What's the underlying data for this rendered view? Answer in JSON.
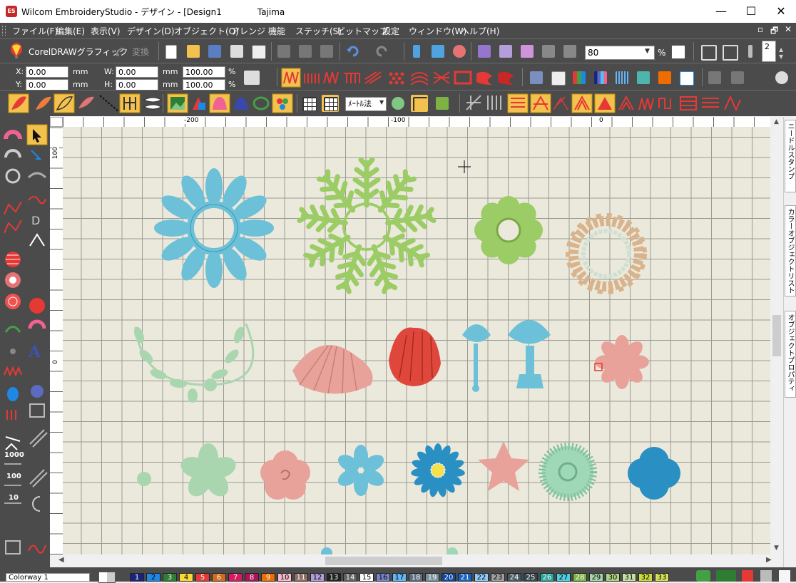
{
  "window": {
    "title": "Wilcom EmbroideryStudio - デザイン - [Design1",
    "machine": "Tajima",
    "app_icon": "ES",
    "controls": {
      "minimize": "—",
      "maximize": "☐",
      "close": "✕"
    }
  },
  "menu": [
    "ファイル(F)",
    "編集(E)",
    "表示(V)",
    "デザイン(D)",
    "オブジェクト(O)",
    "アレンジ",
    "機能",
    "ステッチ(S)",
    "ビットマップ",
    "設定",
    "ウィンドウ(W)",
    "ヘルプ(H)"
  ],
  "mdi_controls": {
    "restore": "▫",
    "maximize": "🗗",
    "close": "✕"
  },
  "toolbar1": {
    "coreldraw_label": "CorelDRAWグラフィック",
    "convert_label": "変換",
    "zoom_value": "80",
    "zoom_unit": "%",
    "spin_value": "2"
  },
  "toolbar2": {
    "x_label": "X:",
    "x_value": "0.00",
    "x_unit": "mm",
    "y_label": "Y:",
    "y_value": "0.00",
    "y_unit": "mm",
    "w_label": "W:",
    "w_value": "0.00",
    "w_unit": "mm",
    "h_label": "H:",
    "h_value": "0.00",
    "h_unit": "mm",
    "w_pct": "100.00",
    "h_pct": "100.00",
    "pct_unit": "%"
  },
  "toolbar3": {
    "method_select": "ﾒｰﾄﾙ法"
  },
  "rulers": {
    "h_labels": [
      "-200",
      "-100",
      "0"
    ],
    "v_labels": [
      "100",
      "0"
    ]
  },
  "toolbox": {
    "numbers": [
      "1000",
      "100",
      "10"
    ]
  },
  "dockers": [
    "ニードルスタンプ",
    "カラーオブジェクトリスト",
    "オブジェクトプロパティ"
  ],
  "statusbar": {
    "colorway": "Colorway 1",
    "swatches": [
      {
        "n": "1",
        "color": "#1a237e"
      },
      {
        "n": "2",
        "color": "#1e88e5"
      },
      {
        "n": "3",
        "color": "#2e7d32"
      },
      {
        "n": "4",
        "color": "#fdd835"
      },
      {
        "n": "5",
        "color": "#e53935"
      },
      {
        "n": "6",
        "color": "#d2691e"
      },
      {
        "n": "7",
        "color": "#d81b60"
      },
      {
        "n": "8",
        "color": "#ad1457"
      },
      {
        "n": "9",
        "color": "#ef6c00"
      },
      {
        "n": "10",
        "color": "#f8bbd0"
      },
      {
        "n": "11",
        "color": "#8d6e63"
      },
      {
        "n": "12",
        "color": "#b39ddb"
      },
      {
        "n": "13",
        "color": "#212121"
      },
      {
        "n": "14",
        "color": "#616161"
      },
      {
        "n": "15",
        "color": "#ffffff"
      },
      {
        "n": "16",
        "color": "#7986cb"
      },
      {
        "n": "17",
        "color": "#64b5f6"
      },
      {
        "n": "18",
        "color": "#5d6d7e"
      },
      {
        "n": "19",
        "color": "#78909c"
      },
      {
        "n": "20",
        "color": "#0d47a1"
      },
      {
        "n": "21",
        "color": "#1565c0"
      },
      {
        "n": "22",
        "color": "#90caf9"
      },
      {
        "n": "23",
        "color": "#9e9e9e"
      },
      {
        "n": "24",
        "color": "#455a64"
      },
      {
        "n": "25",
        "color": "#37474f"
      },
      {
        "n": "26",
        "color": "#26a69a"
      },
      {
        "n": "27",
        "color": "#4dd0e1"
      },
      {
        "n": "28",
        "color": "#7cb342"
      },
      {
        "n": "29",
        "color": "#a5d6a7"
      },
      {
        "n": "30",
        "color": "#aed581"
      },
      {
        "n": "31",
        "color": "#c5e1a5"
      },
      {
        "n": "32",
        "color": "#cddc39"
      },
      {
        "n": "33",
        "color": "#d4e157"
      }
    ]
  },
  "motif_colors": {
    "blue": "#6cc0d8",
    "green": "#9ccc65",
    "tan": "#d9b38c",
    "pearl": "#cfe0d2",
    "sage": "#a9d6ae",
    "salmon": "#e8a29a",
    "red": "#e0473c",
    "teal": "#2a8fc3",
    "yellow": "#f4e24a",
    "mint": "#9fd8b6"
  }
}
